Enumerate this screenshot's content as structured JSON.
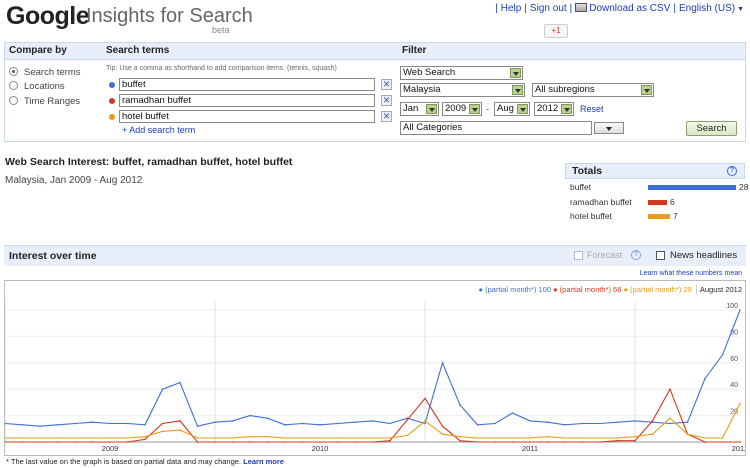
{
  "header": {
    "logo": "Google",
    "product": "Insights for Search",
    "beta": "beta",
    "links": [
      "Help",
      "Sign out",
      "Download as CSV",
      "English (US)"
    ],
    "plus_one": "+1"
  },
  "compare": {
    "heading": "Compare by",
    "options": [
      "Search terms",
      "Locations",
      "Time Ranges"
    ],
    "selected": "Search terms"
  },
  "terms": {
    "heading": "Search terms",
    "tip": "Tip: Use a comma as shorthand to add comparison items. (tennis, squash)",
    "items": [
      {
        "value": "buffet",
        "color": "#3f6ed4"
      },
      {
        "value": "ramadhan buffet",
        "color": "#d4391f"
      },
      {
        "value": "hotel buffet",
        "color": "#e89b15"
      }
    ],
    "add_label": "+ Add search term"
  },
  "filter": {
    "heading": "Filter",
    "search_type": "Web Search",
    "country": "Malaysia",
    "subregion": "All subregions",
    "from_month": "Jan",
    "from_year": "2009",
    "to_month": "Aug",
    "to_year": "2012",
    "reset": "Reset",
    "category": "All Categories",
    "search_button": "Search"
  },
  "headline": {
    "title": "Web Search Interest: buffet, ramadhan buffet, hotel buffet",
    "subtitle": "Malaysia, Jan 2009 - Aug 2012"
  },
  "totals": {
    "title": "Totals",
    "help": "?",
    "items": [
      {
        "label": "buffet",
        "value": "28",
        "color": "#3f6ed4",
        "fraction": 0.49
      },
      {
        "label": "ramadhan buffet",
        "value": "6",
        "color": "#d4391f",
        "fraction": 0.105
      },
      {
        "label": "hotel buffet",
        "value": "7",
        "color": "#e89b15",
        "fraction": 0.123
      }
    ]
  },
  "interest": {
    "title": "Interest over time",
    "forecast": "Forecast",
    "help": "?",
    "news": "News headlines",
    "learn": "Learn what these numbers mean"
  },
  "chart_legend": {
    "blue": "● (partial month*) 100",
    "red": "● (partial month*) 66",
    "orange": "● (partial month*) 29",
    "date": "August 2012"
  },
  "footnote": "* The last value on the graph is based on partial data and may change.",
  "footnote_link": "Learn more",
  "chart_data": {
    "type": "line",
    "x_start": "2009-01",
    "x_end": "2012-08",
    "x_ticks": [
      "2009",
      "2010",
      "2011",
      "2012"
    ],
    "y_ticks": [
      "100",
      "80",
      "60",
      "40",
      "20"
    ],
    "ylim": [
      0,
      100
    ],
    "series": [
      {
        "name": "buffet",
        "color": "#3f6ed4",
        "values": [
          14,
          13,
          12,
          13,
          14,
          15,
          14,
          14,
          13,
          40,
          45,
          12,
          15,
          16,
          20,
          18,
          13,
          14,
          13,
          14,
          15,
          16,
          14,
          18,
          14,
          60,
          28,
          13,
          14,
          22,
          16,
          15,
          13,
          14,
          14,
          15,
          16,
          15,
          14,
          15,
          48,
          66,
          100
        ]
      },
      {
        "name": "ramadhan buffet",
        "color": "#d4391f",
        "values": [
          0,
          0,
          0,
          0,
          0,
          0,
          0,
          0,
          2,
          14,
          16,
          0,
          0,
          0,
          0,
          0,
          0,
          0,
          0,
          0,
          0,
          0,
          1,
          17,
          33,
          12,
          1,
          0,
          0,
          0,
          0,
          0,
          0,
          0,
          0,
          1,
          1,
          16,
          40,
          6,
          0,
          0,
          0
        ]
      },
      {
        "name": "hotel buffet",
        "color": "#e89b15",
        "values": [
          3,
          3,
          3,
          3,
          3,
          3,
          3,
          3,
          4,
          8,
          9,
          3,
          3,
          3,
          4,
          4,
          3,
          3,
          3,
          3,
          3,
          3,
          3,
          5,
          16,
          6,
          4,
          3,
          3,
          3,
          3,
          4,
          3,
          3,
          3,
          3,
          4,
          6,
          18,
          6,
          3,
          3,
          29
        ]
      }
    ]
  }
}
